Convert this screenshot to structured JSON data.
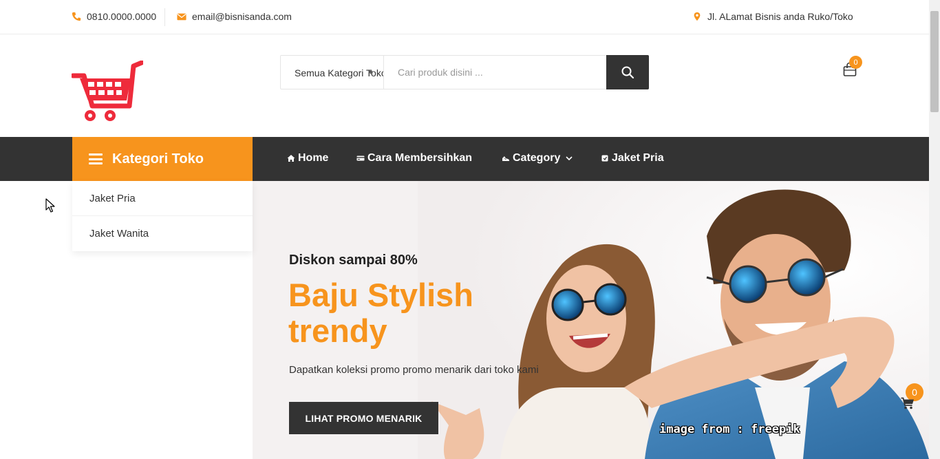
{
  "topbar": {
    "phone": "0810.0000.0000",
    "email": "email@bisnisanda.com",
    "address": "Jl. ALamat Bisnis anda Ruko/Toko",
    "icons": [
      "phone-icon",
      "envelope-icon",
      "map-pin-icon"
    ]
  },
  "header": {
    "logo_icon": "shopping-cart-logo",
    "search": {
      "category_label": "Semua Kategori Toko",
      "placeholder": "Cari produk disini ...",
      "button_icon": "search-icon"
    },
    "cart_count": "0"
  },
  "nav": {
    "category_button_label": "Kategori Toko",
    "items": [
      {
        "label": "Home",
        "icon": "home-icon"
      },
      {
        "label": "Cara Membersihkan",
        "icon": "card-icon"
      },
      {
        "label": "Category",
        "icon": "shoe-icon",
        "has_dropdown": true
      },
      {
        "label": "Jaket Pria",
        "icon": "tag-icon"
      }
    ]
  },
  "category_menu": {
    "items": [
      {
        "label": "Jaket Pria"
      },
      {
        "label": "Jaket Wanita"
      }
    ]
  },
  "hero": {
    "subtitle": "Diskon sampai 80%",
    "title": "Baju Stylish trendy",
    "description": "Dapatkan koleksi promo promo menarik dari toko kami",
    "button_label": "LIHAT PROMO MENARIK",
    "image_credit": "image from : freepik"
  },
  "floating_cart": {
    "count": "0"
  },
  "colors": {
    "accent": "#f7941d",
    "dark": "#333333",
    "logo_red": "#ee2b3b"
  }
}
